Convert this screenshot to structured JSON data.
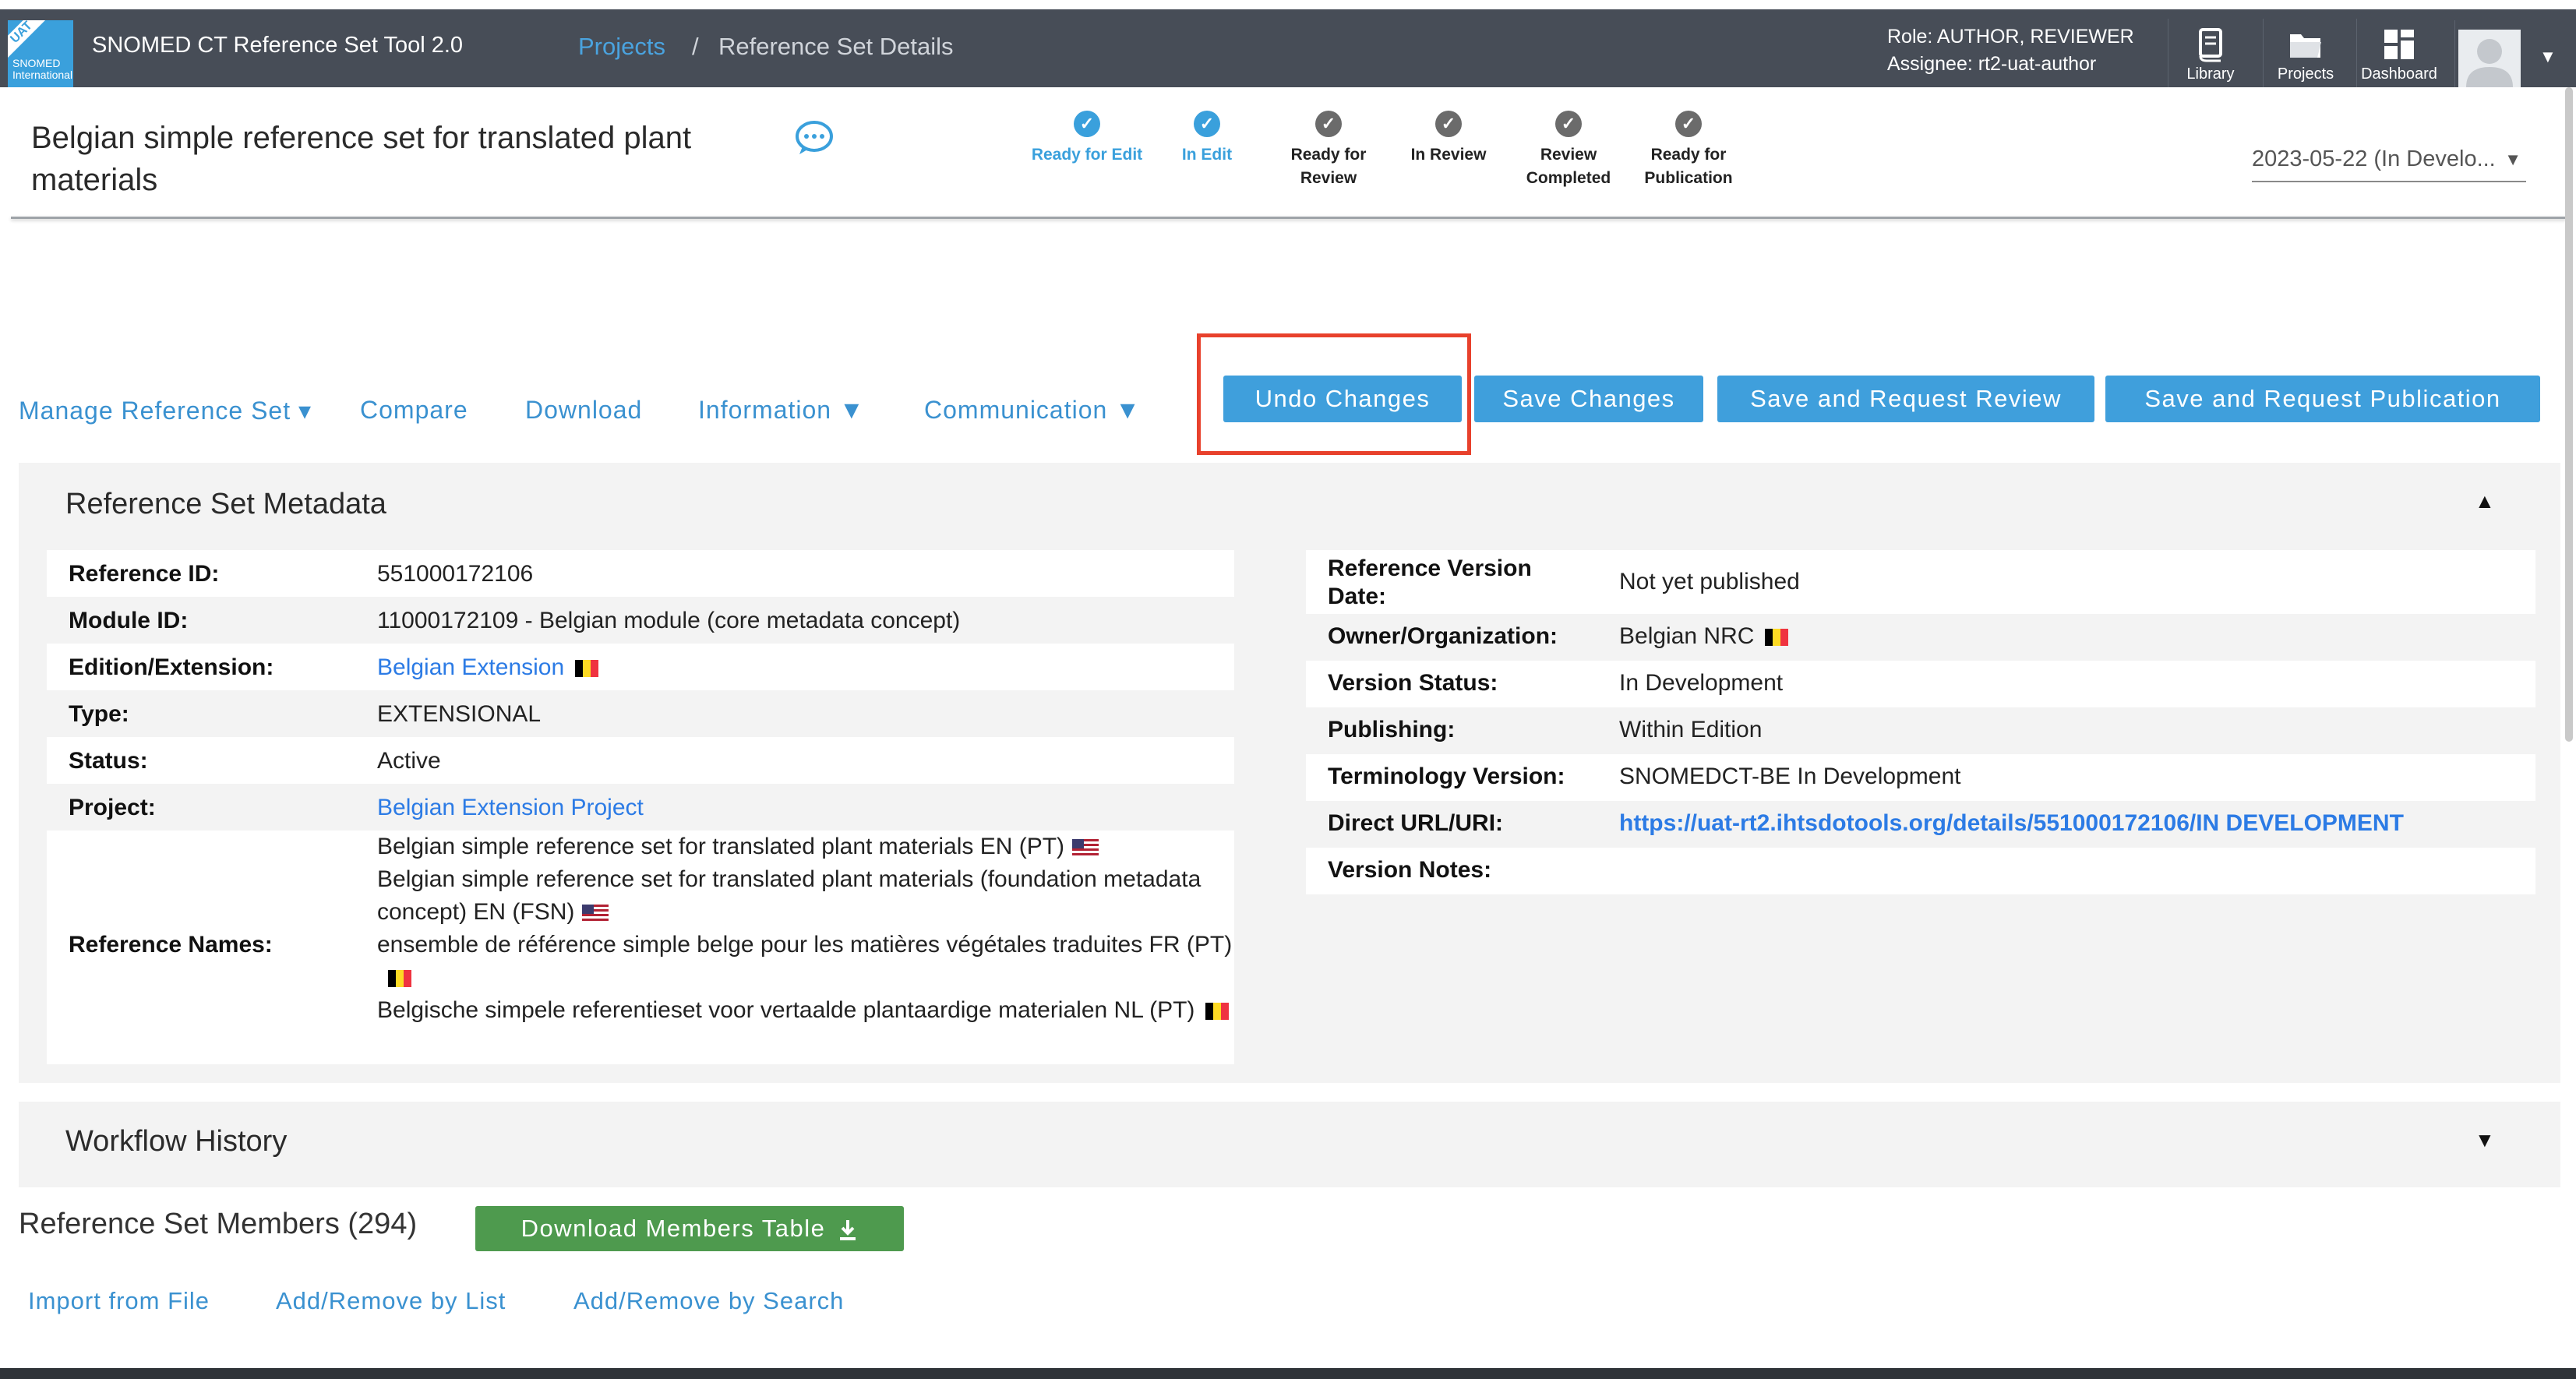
{
  "header": {
    "logo_badge": "UAT",
    "logo_text": "SNOMED International",
    "app_title": "SNOMED CT Reference Set Tool 2.0",
    "breadcrumb_projects": "Projects",
    "breadcrumb_separator": "/",
    "breadcrumb_current": "Reference Set Details",
    "role_line": "Role: AUTHOR, REVIEWER",
    "assignee_line": "Assignee: rt2-uat-author",
    "nav": {
      "library": "Library",
      "projects": "Projects",
      "dashboard": "Dashboard"
    }
  },
  "refset": {
    "title": "Belgian simple reference set for translated plant materials",
    "version_selected": "2023-05-22 (In Develo..."
  },
  "workflow": {
    "steps": [
      {
        "label": "Ready for Edit",
        "state": "done"
      },
      {
        "label": "In Edit",
        "state": "done"
      },
      {
        "label": "Ready for Review",
        "state": "todo"
      },
      {
        "label": "In Review",
        "state": "todo"
      },
      {
        "label": "Review Completed",
        "state": "todo"
      },
      {
        "label": "Ready for Publication",
        "state": "todo"
      }
    ],
    "check_glyph": "✓"
  },
  "actions": {
    "manage": "Manage Reference Set ▾",
    "compare": "Compare",
    "download": "Download",
    "information": "Information ▼",
    "communication": "Communication ▼",
    "undo": "Undo Changes",
    "save": "Save Changes",
    "save_review": "Save and Request Review",
    "save_publication": "Save and Request Publication"
  },
  "metadata": {
    "title": "Reference Set Metadata",
    "left": {
      "reference_id_label": "Reference ID:",
      "reference_id": "551000172106",
      "module_id_label": "Module ID:",
      "module_id": "11000172109 - Belgian module (core metadata concept)",
      "edition_label": "Edition/Extension:",
      "edition": "Belgian Extension",
      "type_label": "Type:",
      "type": "EXTENSIONAL",
      "status_label": "Status:",
      "status": "Active",
      "project_label": "Project:",
      "project": "Belgian Extension Project",
      "names_label": "Reference Names:",
      "names": [
        "Belgian simple reference set for translated plant materials EN (PT)",
        "Belgian simple reference set for translated plant materials (foundation metadata concept) EN (FSN)",
        "ensemble de référence simple belge pour les matières végétales traduites FR (PT)",
        "Belgische simpele referentieset voor vertaalde plantaardige materialen NL (PT)"
      ]
    },
    "right": {
      "version_date_label": "Reference Version Date:",
      "version_date": "Not yet published",
      "owner_label": "Owner/Organization:",
      "owner": "Belgian NRC",
      "version_status_label": "Version Status:",
      "version_status": "In Development",
      "publishing_label": "Publishing:",
      "publishing": "Within Edition",
      "terminology_label": "Terminology Version:",
      "terminology": "SNOMEDCT-BE In Development",
      "url_label": "Direct URL/URI:",
      "url": "https://uat-rt2.ihtsdotools.org/details/551000172106/IN DEVELOPMENT",
      "notes_label": "Version Notes:",
      "notes": ""
    }
  },
  "workflow_history": {
    "title": "Workflow History"
  },
  "members": {
    "title": "Reference Set Members (294)",
    "download_table": "Download Members Table",
    "import_file": "Import from File",
    "add_remove_list": "Add/Remove by List",
    "add_remove_search": "Add/Remove by Search"
  },
  "colors": {
    "header_bg": "#474d57",
    "accent_blue": "#3f9fdc",
    "link_blue": "#2c7be5",
    "green_button": "#4e9a4e",
    "highlight_red": "#e8412c"
  }
}
